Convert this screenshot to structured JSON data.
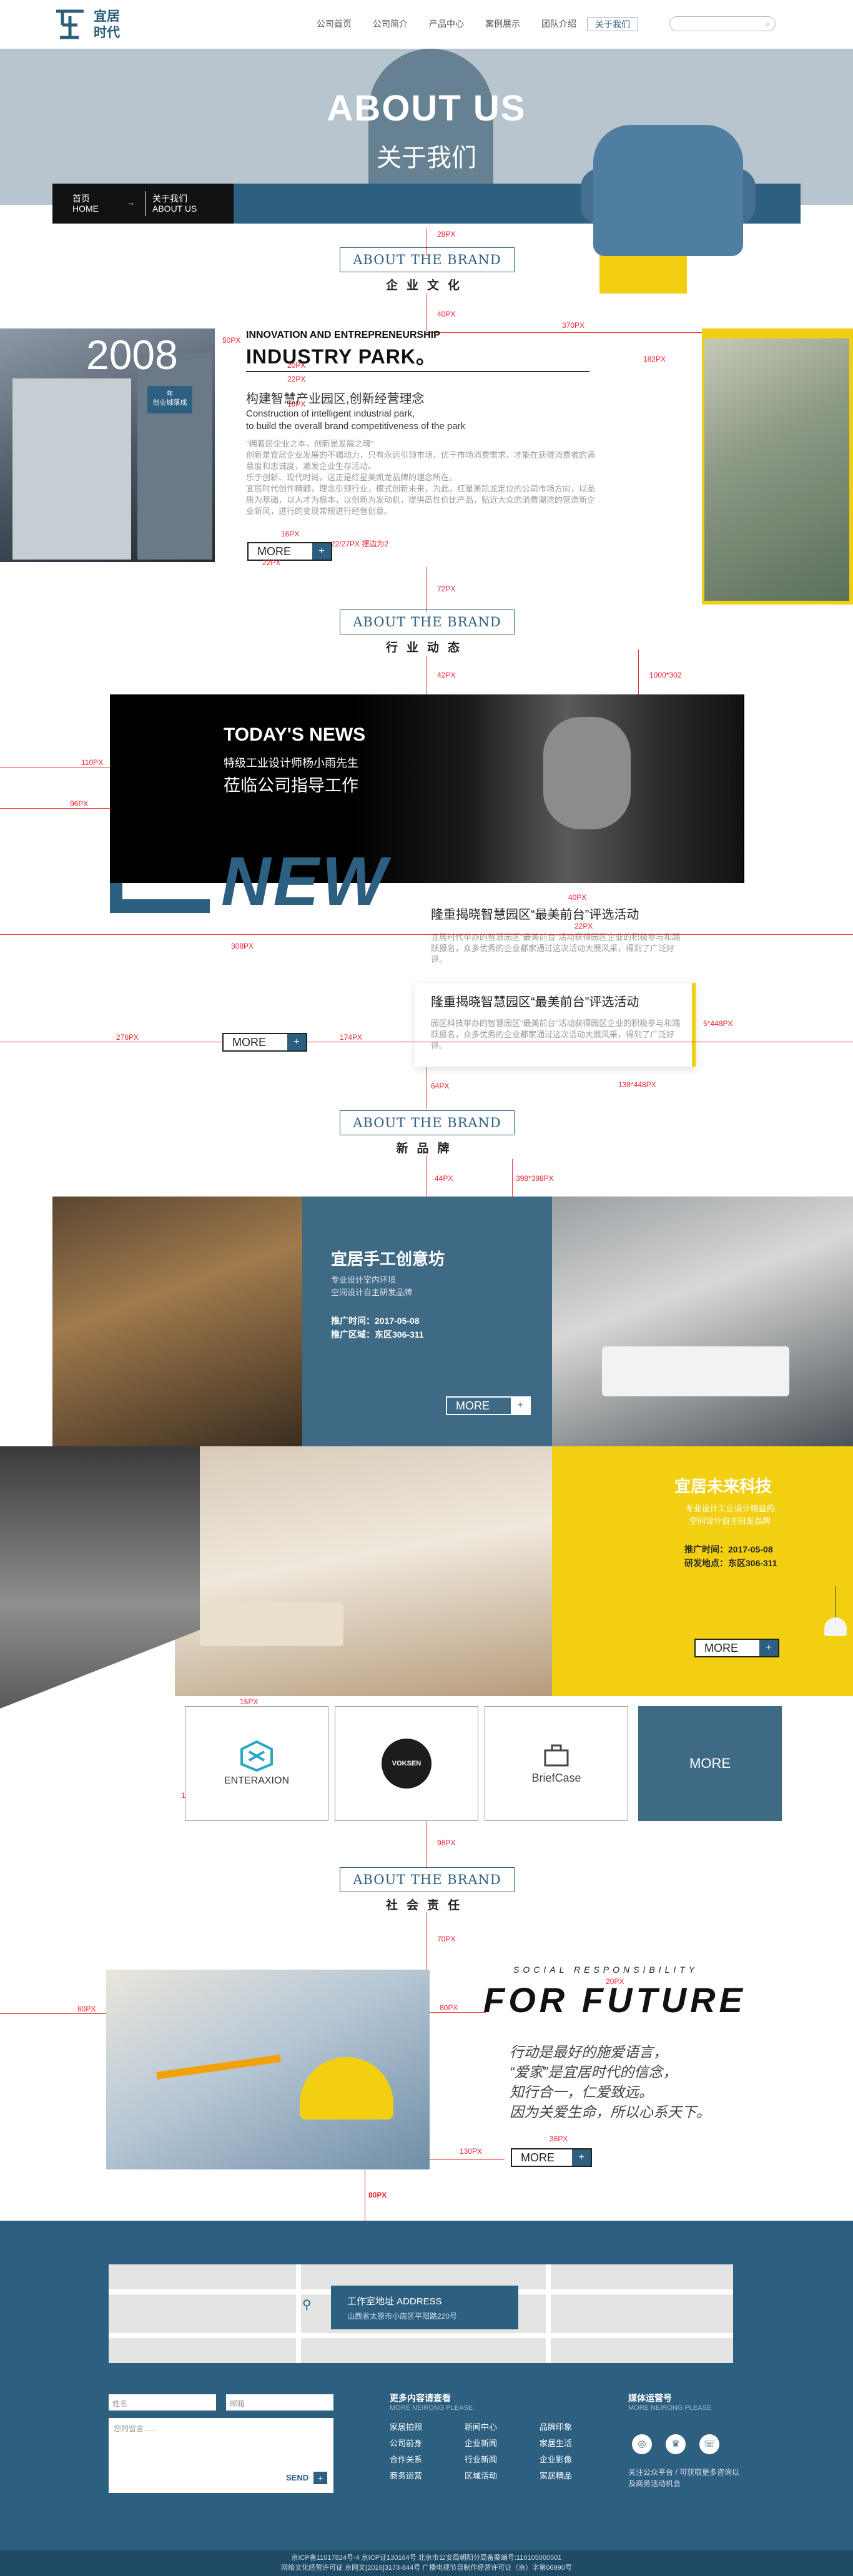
{
  "header": {
    "logo": "宜居\n时代",
    "nav": [
      "公司首页",
      "公司简介",
      "产品中心",
      "案例展示",
      "团队介绍",
      "关于我们"
    ],
    "active": "关于我们",
    "search_icon": "search-icon"
  },
  "banner": {
    "title": "ABOUT US",
    "subtitle": "关于我们",
    "crumb_home": "首页",
    "crumb_home_en": "HOME",
    "crumb_arrow": "→",
    "crumb_cur": "关于我们",
    "crumb_cur_en": "ABOUT US"
  },
  "sections": {
    "brand_en": "ABOUT THE BRAND",
    "culture_cn": "企业文化",
    "news_cn": "行业动态",
    "product_cn": "新品牌",
    "social_cn": "社会责任"
  },
  "culture": {
    "year": "2008",
    "year_tag": "年\n创业城落成",
    "inno": "INNOVATION AND ENTREPRENEURSHIP",
    "industry": "INDUSTRY PARK。",
    "heading": "构建智慧产业园区,创新经营理念",
    "en1": "Construction of intelligent industrial park,",
    "en2": "to build the overall brand competitiveness of the park",
    "para": "\"拥着居企业之本，创新是发展之魂\"\n创新是宜居企业发展的不竭动力，只有永远引领市场，优于市场消费需求，才能在获得消费者的满意度和忠诚度，激发企业生存活动。\n乐于创新、现代时尚，这正是红星美凯龙品牌的理念所在。\n宜居时代创作精髓，理念引领行业，模式创新未来，为此，红星美凯龙定位的公司市场方向，以品质为基础，以人才为根本，以创新为发动机，提供高性价比产品，贴近大众的消费潮流的营造新企业新风，进行的变现常规进行经营创意。",
    "more": "MORE",
    "plus": "+"
  },
  "news": {
    "title": "TODAY'S NEWS",
    "sub1": "特级工业设计师杨小雨先生",
    "sub2": "莅临公司指导工作",
    "big": "NEW",
    "item1_h": "隆重揭晓智慧园区“最美前台”评选活动",
    "item1_p": "宜居时代举办的智慧园区\"最美前台\"活动获得园区企业的积极参与和踊跃报名，众多优秀的企业都家通过这次活动大展风采，得到了广泛好评。",
    "item2_h": "隆重揭晓智慧园区“最美前台”评选活动",
    "item2_p": "园区科技举办的智慧园区\"最美前台\"活动获得园区企业的积极参与和踊跃报名，众多优秀的企业都家通过这次活动大展风采，得到了广泛好评。",
    "more": "MORE",
    "plus": "+"
  },
  "products": {
    "p1_title": "宜居手工创意坊",
    "p1_sub": "专业设计室内环境\n空间设计自主研发品牌",
    "p1_info": "推广时间：2017-05-08\n推广区域：东区306-311",
    "p2_title": "宜居未来科技",
    "p2_sub": "专业设计工业设计精益的\n空间设计自主研发品牌",
    "p2_info": "推广时间：2017-05-08\n研发地点：东区306-311",
    "more": "MORE",
    "plus": "+",
    "brands": [
      "ENTERAXION",
      "VOKSEN",
      "BriefCase"
    ],
    "brand_more": "MORE"
  },
  "social": {
    "small": "SOCIAL RESPONSIBILITY",
    "big": "FOR FUTURE",
    "text": "行动是最好的施爱语言，\n“爱家”是宜居时代的信念，\n知行合一，仁爱致远。\n因为关爱生命，所以心系天下。",
    "more": "MORE",
    "plus": "+"
  },
  "footer": {
    "addr_t1": "工作室地址 ADDRESS",
    "addr_t2": "山西省太原市小店区平阳路220号",
    "name_ph": "姓名",
    "mail_ph": "邮箱",
    "msg_ph": "您的留言......",
    "send": "SEND",
    "plus": "+",
    "col1_h": "更多内容请查看",
    "col1_h2": "MORE NEIRONG PLEASE",
    "links": [
      "家居拍照",
      "新闻中心",
      "品牌印象",
      "公司前身",
      "企业新闻",
      "家居生活",
      "合作关系",
      "行业新闻",
      "企业影像",
      "商务运营",
      "区域活动",
      "家居精品"
    ],
    "col2_h": "媒体运营号",
    "col2_h2": "MORE NEIRONG PLEASE",
    "icons": [
      "◎",
      "♛",
      "☏"
    ],
    "follow": "关注公众平台 / 可获取更多咨询以及商务活动机会",
    "copyright1": "京ICP备11017824号-4   京ICP证130164号   北京市公安局朝阳分局备案编号:110105000501",
    "copyright2": "网络文化经营许可证 京网文[2016]3173-844号   广播电视节目制作经营许可证（京）字第06990号"
  },
  "annotations": [
    "28PX",
    "40PX",
    "370PX",
    "50PX",
    "20PX",
    "22PX",
    "16PX",
    "182PX",
    "16PX",
    "22PX",
    "22/27PX 摆边为2",
    "72PX",
    "42PX",
    "1000*302",
    "110PX",
    "96PX",
    "40PX",
    "22PX",
    "308PX",
    "276PX",
    "174PX",
    "5*448PX",
    "138*448PX",
    "64PX",
    "44PX",
    "398*398PX",
    "15PX",
    "12PX",
    "98PX",
    "70PX",
    "80PX",
    "80PX",
    "130PX",
    "36PX",
    "80PX",
    "98PX",
    "20PX",
    "20PX"
  ]
}
